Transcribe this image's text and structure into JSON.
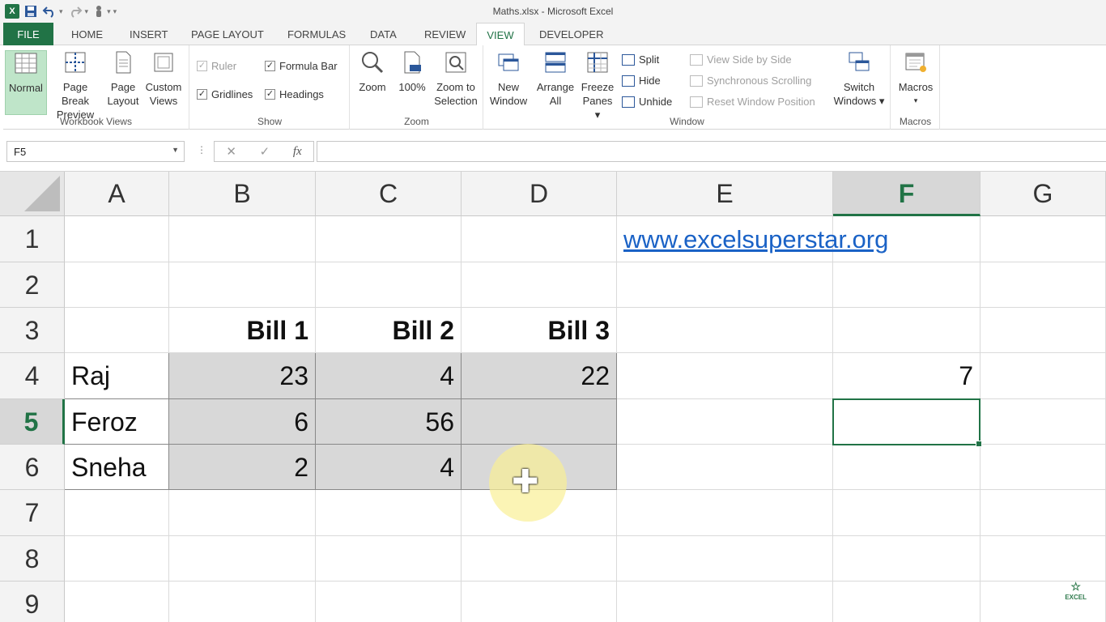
{
  "window": {
    "title": "Maths.xlsx - Microsoft Excel"
  },
  "qat": {
    "logo": "X",
    "save_icon": "save-icon",
    "undo_icon": "undo-icon",
    "redo_icon": "redo-icon",
    "touch_icon": "touch-mode-icon"
  },
  "tabs": [
    "FILE",
    "HOME",
    "INSERT",
    "PAGE LAYOUT",
    "FORMULAS",
    "DATA",
    "REVIEW",
    "VIEW",
    "DEVELOPER"
  ],
  "active_tab": "VIEW",
  "ribbon": {
    "workbook_views": {
      "label": "Workbook Views",
      "normal": "Normal",
      "page_break_1": "Page Break",
      "page_break_2": "Preview",
      "page_layout_1": "Page",
      "page_layout_2": "Layout",
      "custom_views_1": "Custom",
      "custom_views_2": "Views"
    },
    "show": {
      "label": "Show",
      "ruler": "Ruler",
      "formula_bar": "Formula Bar",
      "gridlines": "Gridlines",
      "headings": "Headings"
    },
    "zoom": {
      "label": "Zoom",
      "zoom": "Zoom",
      "hundred": "100%",
      "zoom_sel_1": "Zoom to",
      "zoom_sel_2": "Selection"
    },
    "window": {
      "label": "Window",
      "new_1": "New",
      "new_2": "Window",
      "arrange_1": "Arrange",
      "arrange_2": "All",
      "freeze_1": "Freeze",
      "freeze_2": "Panes ▾",
      "split": "Split",
      "hide": "Hide",
      "unhide": "Unhide",
      "side_by_side": "View Side by Side",
      "sync_scroll": "Synchronous Scrolling",
      "reset_pos": "Reset Window Position",
      "switch_1": "Switch",
      "switch_2": "Windows ▾"
    },
    "macros": {
      "label": "Macros",
      "btn": "Macros",
      "arrow": "▾"
    }
  },
  "formula_bar": {
    "name_box": "F5",
    "cancel": "✕",
    "enter": "✓",
    "fx": "fx",
    "value": ""
  },
  "columns": [
    "A",
    "B",
    "C",
    "D",
    "E",
    "F",
    "G"
  ],
  "rows": [
    "1",
    "2",
    "3",
    "4",
    "5",
    "6",
    "7",
    "8",
    "9"
  ],
  "cells": {
    "E1": "www.excelsuperstar.org",
    "B3": "Bill 1",
    "C3": "Bill 2",
    "D3": "Bill 3",
    "A4": "Raj",
    "B4": "23",
    "C4": "4",
    "D4": "22",
    "F4": "7",
    "A5": "Feroz",
    "B5": "6",
    "C5": "56",
    "D5": "",
    "A6": "Sneha",
    "B6": "2",
    "C6": "4",
    "D6": ""
  },
  "watermark": "EXCEL"
}
